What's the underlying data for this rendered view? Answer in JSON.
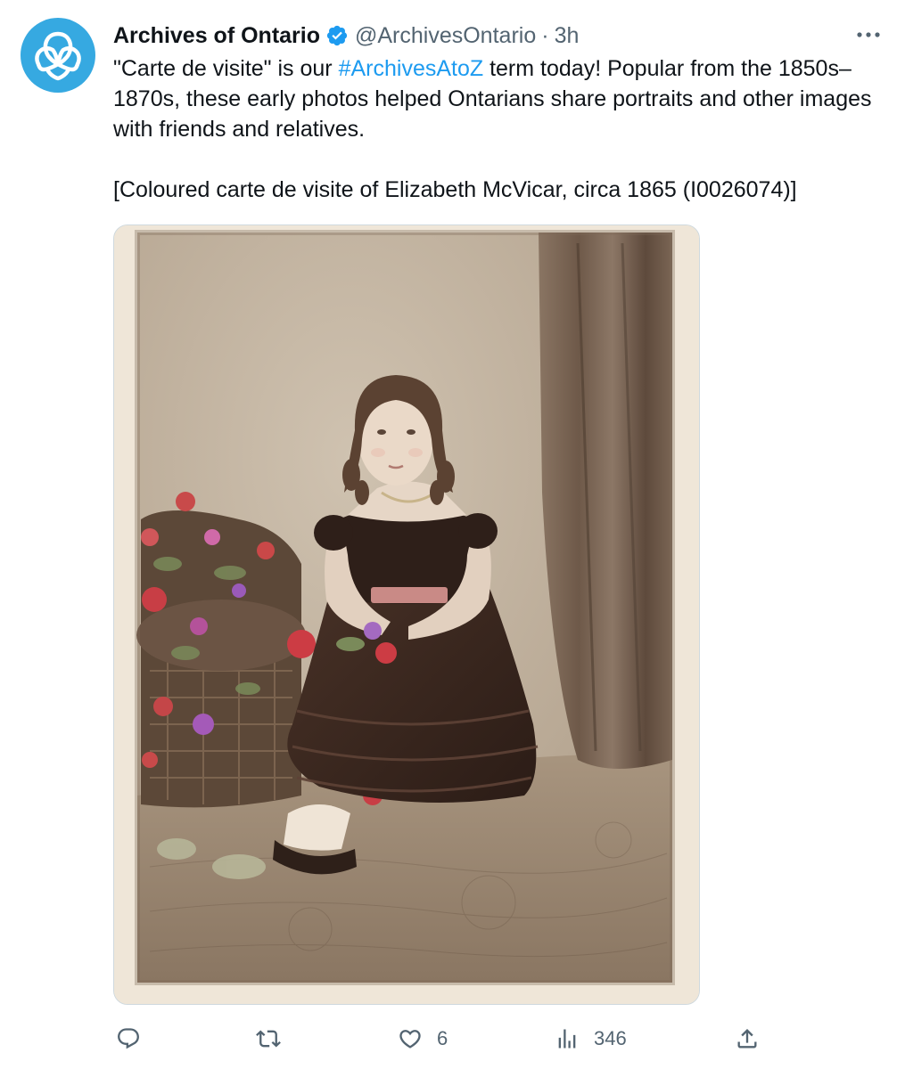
{
  "tweet": {
    "author": {
      "display_name": "Archives of Ontario",
      "handle": "@ArchivesOntario",
      "verified_icon": "verified-badge-icon",
      "avatar_icon": "ontario-trillium-logo"
    },
    "separator": "·",
    "timestamp": "3h",
    "more_icon": "more-options-icon",
    "text": {
      "part1": "\"Carte de visite\" is our ",
      "hashtag": "#ArchivesAtoZ",
      "part2": " term today! Popular from the 1850s–1870s, these early photos helped Ontarians share portraits and other images with friends and relatives.",
      "caption": "[Coloured carte de visite of Elizabeth McVicar, circa 1865 (I0026074)]"
    },
    "actions": {
      "reply": {
        "icon": "reply-icon",
        "count": ""
      },
      "retweet": {
        "icon": "retweet-icon",
        "count": ""
      },
      "like": {
        "icon": "heart-icon",
        "count": "6"
      },
      "views": {
        "icon": "views-chart-icon",
        "count": "346"
      },
      "share": {
        "icon": "share-icon",
        "count": ""
      }
    }
  },
  "colors": {
    "text": "#0f1419",
    "secondary": "#536471",
    "link": "#1d9bf0",
    "avatar_bg": "#36a9e1",
    "verified": "#1d9bf0"
  }
}
